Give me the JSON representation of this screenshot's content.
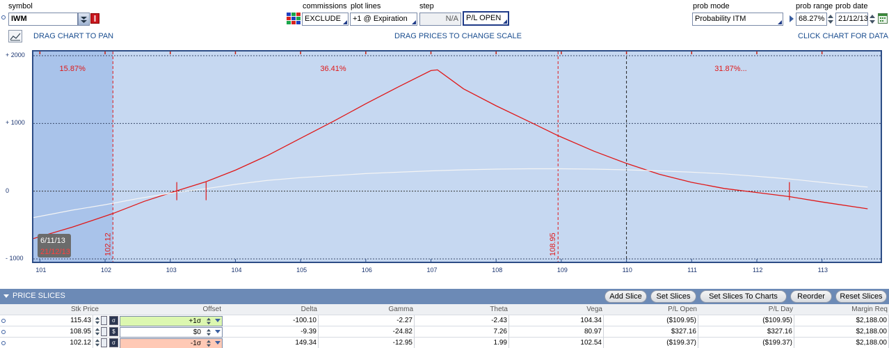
{
  "toolbar": {
    "symbol_label": "symbol",
    "symbol_value": "IWM",
    "commissions_label": "commissions",
    "commissions_value": "EXCLUDE",
    "plot_lines_label": "plot lines",
    "plot_lines_value": "+1 @ Expiration",
    "step_label": "step",
    "step_value": "N/A",
    "pl_value": "P/L OPEN",
    "prob_mode_label": "prob mode",
    "prob_mode_value": "Probability ITM",
    "prob_range_label": "prob range",
    "prob_range_value": "68.27%",
    "prob_date_label": "prob date",
    "prob_date_value": "21/12/13"
  },
  "hints": {
    "drag_pan": "DRAG CHART TO PAN",
    "drag_prices": "DRAG PRICES TO CHANGE SCALE",
    "click_chart": "CLICK CHART FOR DATA"
  },
  "chart_data": {
    "type": "line",
    "xlim": [
      100.9,
      113.9
    ],
    "ylim": [
      -1000,
      2000
    ],
    "x_ticks": [
      "101",
      "102",
      "103",
      "104",
      "105",
      "106",
      "107",
      "108",
      "109",
      "110",
      "111",
      "112",
      "113"
    ],
    "y_ticks": [
      {
        "label": "+ 2000",
        "value": 2000
      },
      {
        "label": "+ 1000",
        "value": 1000
      },
      {
        "label": "0",
        "value": 0
      },
      {
        "label": "- 1000",
        "value": -1000
      }
    ],
    "series": [
      {
        "color": "#e01818",
        "points": [
          [
            100.9,
            -700
          ],
          [
            101.5,
            -530
          ],
          [
            102.12,
            -330
          ],
          [
            102.6,
            -150
          ],
          [
            103.08,
            0
          ],
          [
            103.55,
            140
          ],
          [
            104.0,
            310
          ],
          [
            104.5,
            530
          ],
          [
            105.0,
            780
          ],
          [
            105.5,
            1030
          ],
          [
            106.0,
            1290
          ],
          [
            106.5,
            1540
          ],
          [
            107.0,
            1780
          ],
          [
            107.1,
            1790
          ],
          [
            107.5,
            1510
          ],
          [
            108.0,
            1260
          ],
          [
            108.5,
            1030
          ],
          [
            108.95,
            820
          ],
          [
            109.5,
            590
          ],
          [
            110.0,
            410
          ],
          [
            110.5,
            250
          ],
          [
            111.0,
            130
          ],
          [
            111.5,
            40
          ],
          [
            112.0,
            -20
          ],
          [
            112.5,
            -80
          ],
          [
            113.0,
            -160
          ],
          [
            113.7,
            -260
          ]
        ]
      },
      {
        "color": "#f4f4f4",
        "points": [
          [
            100.9,
            -390
          ],
          [
            101.5,
            -280
          ],
          [
            102.0,
            -200
          ],
          [
            102.5,
            -110
          ],
          [
            103.0,
            -30
          ],
          [
            103.5,
            30
          ],
          [
            104.0,
            100
          ],
          [
            104.5,
            160
          ],
          [
            105.0,
            200
          ],
          [
            105.5,
            230
          ],
          [
            106.0,
            260
          ],
          [
            106.5,
            280
          ],
          [
            107.0,
            300
          ],
          [
            107.5,
            315
          ],
          [
            108.0,
            325
          ],
          [
            108.5,
            330
          ],
          [
            109.0,
            330
          ],
          [
            109.5,
            325
          ],
          [
            110.0,
            315
          ],
          [
            110.5,
            300
          ],
          [
            111.0,
            280
          ],
          [
            111.5,
            255
          ],
          [
            112.0,
            220
          ],
          [
            112.5,
            180
          ],
          [
            113.0,
            130
          ],
          [
            113.7,
            60
          ]
        ]
      }
    ],
    "pl_crossings": [
      103.1,
      103.55,
      112.5
    ],
    "vlines": [
      {
        "x": 102.12,
        "label": "102.12",
        "color": "#e01818"
      },
      {
        "x": 108.95,
        "label": "108.95",
        "color": "#e01818"
      },
      {
        "x": 110.0,
        "label": "",
        "color": "#222"
      }
    ],
    "shaded_until_x": 102.12,
    "probabilities": [
      {
        "x": 101.5,
        "label": "15.87%"
      },
      {
        "x": 105.5,
        "label": "36.41%"
      },
      {
        "x": 111.6,
        "label": "31.87%..."
      }
    ],
    "date_badge": {
      "line1": "6/11/13",
      "line2": "21/12/13"
    }
  },
  "price_slices": {
    "title": "PRICE SLICES",
    "buttons": [
      "Add Slice",
      "Set Slices",
      "Set Slices To Charts",
      "Reorder",
      "Reset Slices"
    ],
    "columns": [
      "Stk Price",
      "Offset",
      "Delta",
      "Gamma",
      "Theta",
      "Vega",
      "P/L Open",
      "P/L Day",
      "Margin Req"
    ],
    "rows": [
      {
        "stk_price": "115.43",
        "mode": "σ",
        "offset": "+1σ",
        "offset_color": "#dcf7b0",
        "delta": "-100.10",
        "gamma": "-2.27",
        "theta": "-2.43",
        "vega": "104.34",
        "pl_open": "($109.95)",
        "pl_day": "($109.95)",
        "margin": "$2,188.00"
      },
      {
        "stk_price": "108.95",
        "mode": "$",
        "offset": "$0",
        "offset_color": "#ffffff",
        "delta": "-9.39",
        "gamma": "-24.82",
        "theta": "7.26",
        "vega": "80.97",
        "pl_open": "$327.16",
        "pl_day": "$327.16",
        "margin": "$2,188.00"
      },
      {
        "stk_price": "102.12",
        "mode": "σ",
        "offset": "-1σ",
        "offset_color": "#ffc9b5",
        "delta": "149.34",
        "gamma": "-12.95",
        "theta": "1.99",
        "vega": "102.54",
        "pl_open": "($199.37)",
        "pl_day": "($199.37)",
        "margin": "$2,188.00"
      }
    ]
  }
}
